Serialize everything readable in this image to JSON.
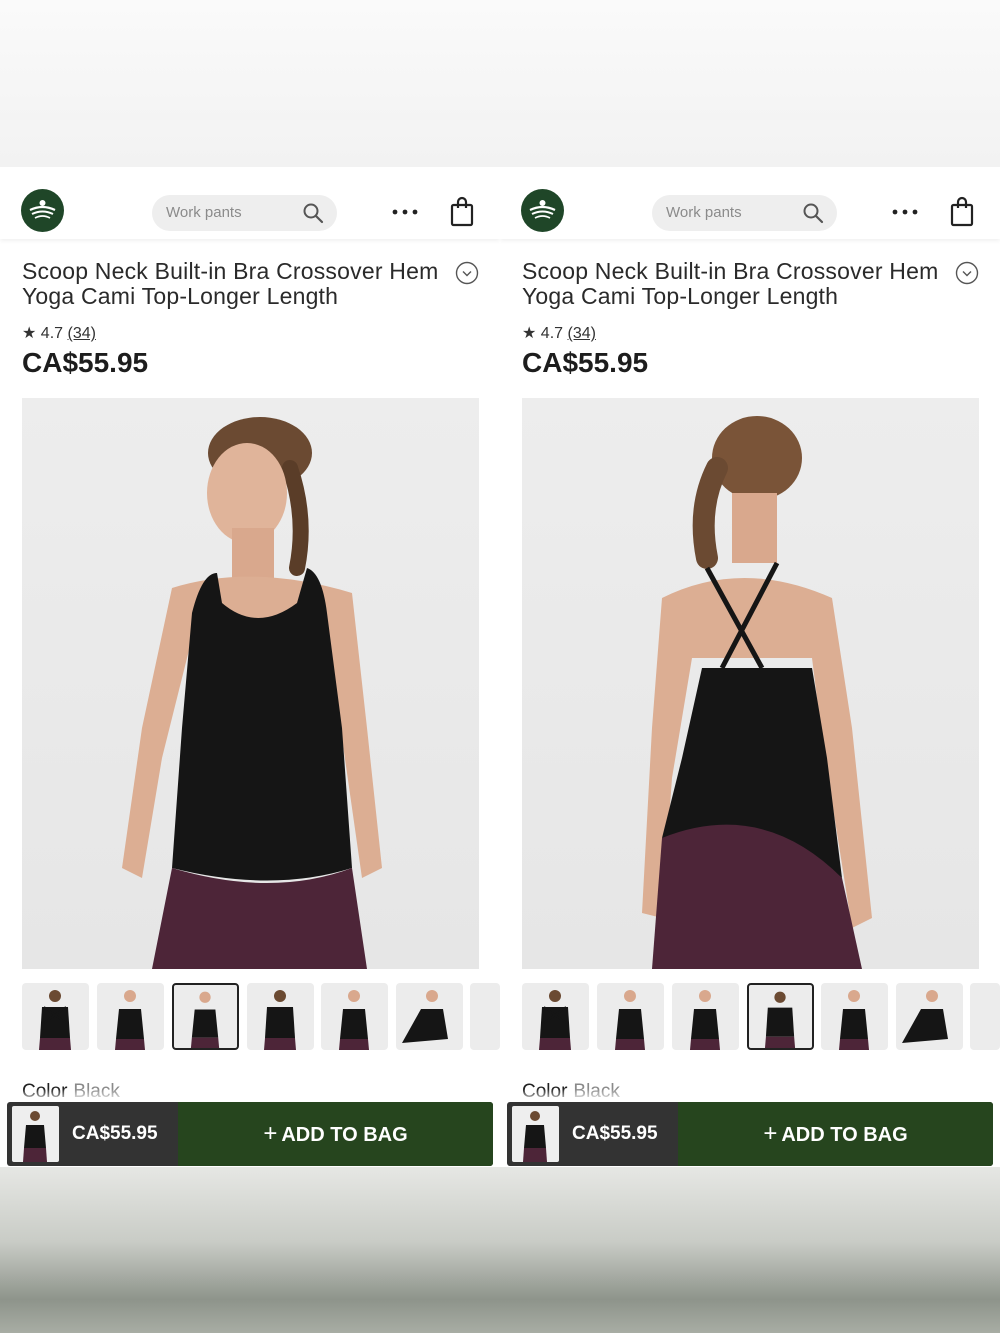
{
  "panels": [
    {
      "search": {
        "placeholder": "Work pants"
      },
      "product": {
        "title": "Scoop Neck Built-in Bra Crossover Hem Yoga Cami Top-Longer Length",
        "rating": "4.7",
        "review_count": "(34)",
        "price": "CA$55.95"
      },
      "hero_view": "front",
      "thumbnails": [
        "back",
        "front",
        "front",
        "back",
        "front",
        "side",
        "partial"
      ],
      "selected_thumbnail_index": 2,
      "color_label": "Color",
      "color_value": "Black",
      "cart": {
        "price": "CA$55.95",
        "add_label": "ADD TO BAG"
      }
    },
    {
      "search": {
        "placeholder": "Work pants"
      },
      "product": {
        "title": "Scoop Neck Built-in Bra Crossover Hem Yoga Cami Top-Longer Length",
        "rating": "4.7",
        "review_count": "(34)",
        "price": "CA$55.95"
      },
      "hero_view": "back",
      "thumbnails": [
        "back",
        "front",
        "front",
        "back",
        "front",
        "side",
        "partial"
      ],
      "selected_thumbnail_index": 3,
      "color_label": "Color",
      "color_value": "Black",
      "cart": {
        "price": "CA$55.95",
        "add_label": "ADD TO BAG"
      }
    }
  ],
  "colors": {
    "brand_green": "#1f4628",
    "add_button": "#26451e",
    "cart_dark": "#333333",
    "top_black": "#151515",
    "leggings_plum": "#4d2538"
  },
  "icons": [
    "logo-icon",
    "search-icon",
    "more-dots-icon",
    "shopping-bag-icon",
    "chevron-down-icon",
    "star-icon",
    "plus-icon"
  ]
}
